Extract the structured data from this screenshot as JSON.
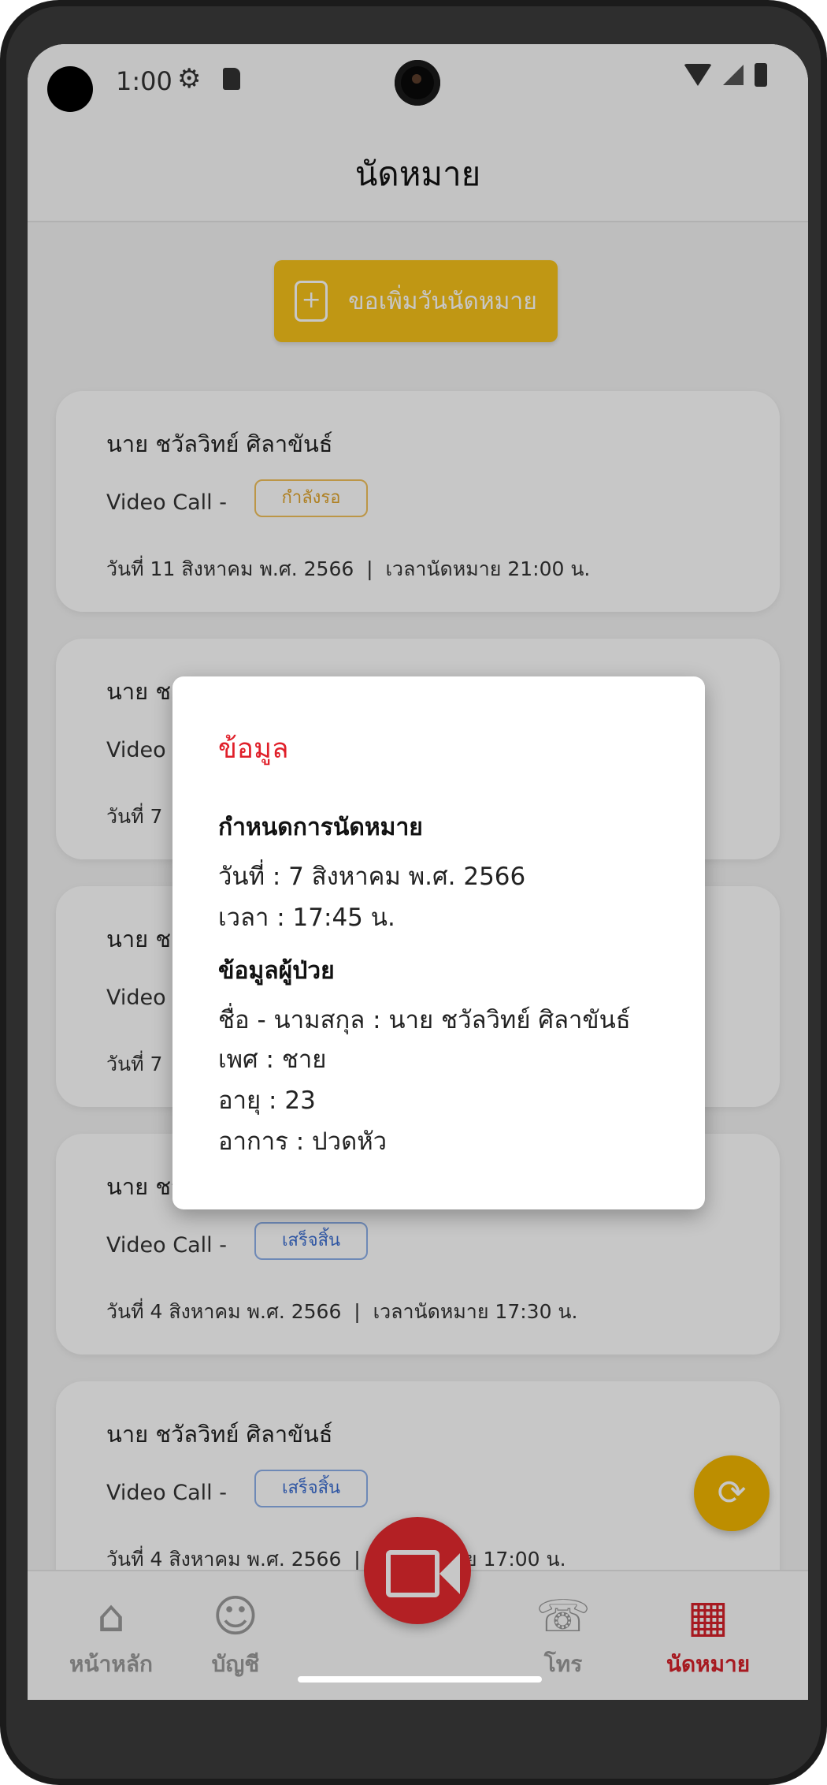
{
  "status_bar": {
    "time": "1:00"
  },
  "header": {
    "title": "นัดหมาย"
  },
  "add_button": {
    "label": "ขอเพิ่มวันนัดหมาย",
    "color": "#f6c21a"
  },
  "appointments": [
    {
      "name": "นาย ชวัลวิทย์ ศิลาขันธ์",
      "service": "Video Call",
      "separator": "-",
      "status": "กำลังรอ",
      "date": "วันที่ 11 สิงหาคม พ.ศ. 2566",
      "time": "เวลานัดหมาย 21:00 น."
    },
    {
      "name": "นาย ช",
      "service": "Video",
      "separator": "",
      "status": "",
      "date": "วันที่ 7",
      "time": ""
    },
    {
      "name": "นาย ช",
      "service": "Video",
      "separator": "",
      "status": "",
      "date": "วันที่ 7",
      "time": ""
    },
    {
      "name": "นาย ชวัลวิทย์ ศิลาขันธ์",
      "service": "Video Call",
      "separator": "-",
      "status": "เสร็จสิ้น",
      "date": "วันที่ 4 สิงหาคม พ.ศ. 2566",
      "time": "เวลานัดหมาย 17:30 น."
    },
    {
      "name": "นาย ชวัลวิทย์ ศิลาขันธ์",
      "service": "Video Call",
      "separator": "-",
      "status": "เสร็จสิ้น",
      "date": "วันที่ 4 สิงหาคม พ.ศ. 2566",
      "time": "าย 17:00 น."
    }
  ],
  "modal": {
    "title": "ข้อมูล",
    "schedule_heading": "กำหนดการนัดหมาย",
    "date_line": "วันที่ : 7 สิงหาคม พ.ศ. 2566",
    "time_line": "เวลา : 17:45 น.",
    "patient_heading": "ข้อมูลผู้ป่วย",
    "name_line": "ชื่อ - นามสกุล : นาย ชวัลวิทย์ ศิลาขันธ์",
    "gender_line": "เพศ : ชาย",
    "age_line": "อายุ : 23",
    "symptom_line": "อาการ : ปวดหัว",
    "title_color": "#e0202a"
  },
  "bottom_nav": {
    "items": [
      {
        "label": "หน้าหลัก",
        "icon": "home-icon"
      },
      {
        "label": "บัญชี",
        "icon": "account-icon"
      },
      {
        "label": "โทร",
        "icon": "phone-icon"
      },
      {
        "label": "นัดหมาย",
        "icon": "calendar-icon",
        "active": true
      }
    ],
    "active_color": "#d6202a"
  }
}
